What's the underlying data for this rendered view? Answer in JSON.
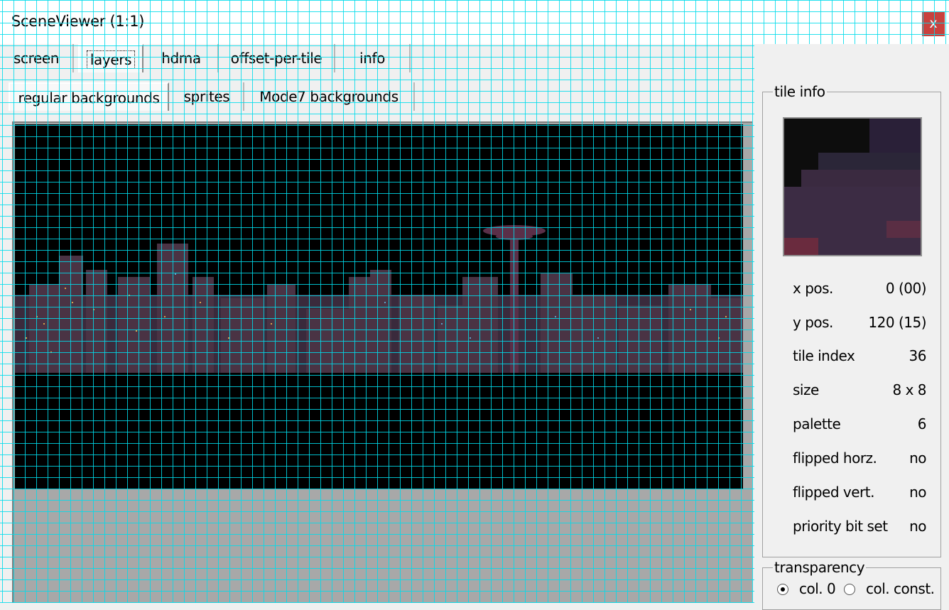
{
  "window": {
    "title": "SceneViewer (1:1)",
    "close_label": "x"
  },
  "tabs_main": [
    {
      "label": "screen"
    },
    {
      "label": "layers"
    },
    {
      "label": "hdma"
    },
    {
      "label": "offset-per-tile"
    },
    {
      "label": "info"
    }
  ],
  "tabs_main_selected": "layers",
  "tabs_sub": [
    {
      "label": "regular backgrounds"
    },
    {
      "label": "sprites"
    },
    {
      "label": "Mode7 backgrounds"
    }
  ],
  "tabs_sub_selected": "regular backgrounds",
  "tile_info": {
    "title": "tile info",
    "rows": [
      {
        "key": "x pos.",
        "value": "0 (00)"
      },
      {
        "key": "y pos.",
        "value": "120 (15)"
      },
      {
        "key": "tile index",
        "value": "36"
      },
      {
        "key": "size",
        "value": "8 x 8"
      },
      {
        "key": "palette",
        "value": "6"
      },
      {
        "key": "flipped horz.",
        "value": "no"
      },
      {
        "key": "flipped vert.",
        "value": "no"
      },
      {
        "key": "priority bit set",
        "value": "no"
      }
    ]
  },
  "transparency": {
    "title": "transparency",
    "options": [
      {
        "label": "col. 0",
        "checked": true
      },
      {
        "label": "col. const.",
        "checked": false
      }
    ]
  },
  "colors": {
    "close_button": "#c9413e",
    "grid": "#00dceb",
    "scene_background": "#000000",
    "canvas_gray": "#a8a8a8"
  }
}
